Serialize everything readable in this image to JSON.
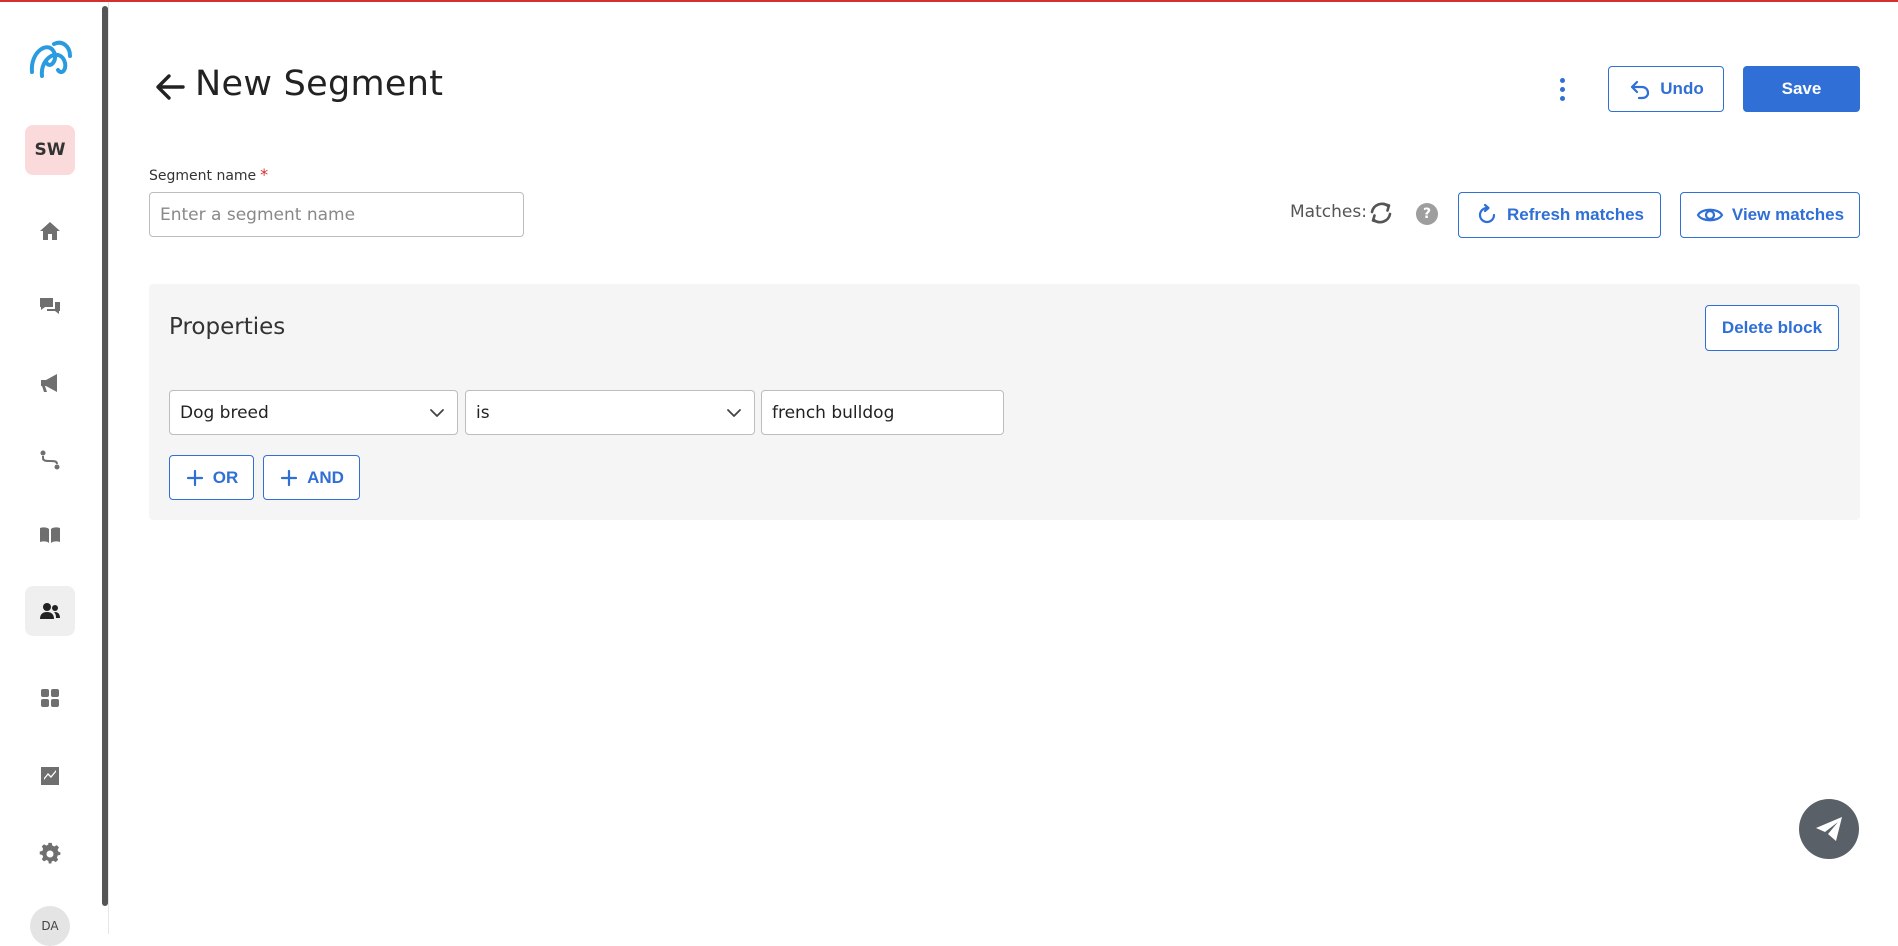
{
  "sidebar": {
    "workspace_initials": "SW",
    "user_initials": "DA",
    "items": [
      {
        "icon": "home-icon"
      },
      {
        "icon": "chat-bubbles-icon"
      },
      {
        "icon": "megaphone-icon"
      },
      {
        "icon": "route-icon"
      },
      {
        "icon": "book-icon"
      },
      {
        "icon": "people-icon",
        "active": true
      },
      {
        "icon": "apps-grid-icon"
      },
      {
        "icon": "chart-icon"
      },
      {
        "icon": "gear-icon"
      }
    ]
  },
  "header": {
    "title": "New Segment",
    "undo_label": "Undo",
    "save_label": "Save"
  },
  "segment": {
    "name_label": "Segment name",
    "required_marker": "*",
    "name_placeholder": "Enter a segment name",
    "name_value": ""
  },
  "matches": {
    "label": "Matches:",
    "help": "?",
    "refresh_label": "Refresh matches",
    "view_label": "View matches"
  },
  "properties": {
    "title": "Properties",
    "delete_label": "Delete block",
    "condition": {
      "property": "Dog breed",
      "operator": "is",
      "value": "french bulldog"
    },
    "or_label": "OR",
    "and_label": "AND"
  },
  "colors": {
    "accent": "#2f6fd6",
    "top_bar": "#d32f2f",
    "workspace_badge": "#fadada",
    "block_bg": "#f5f5f5",
    "chat_fab": "#5a6067"
  }
}
